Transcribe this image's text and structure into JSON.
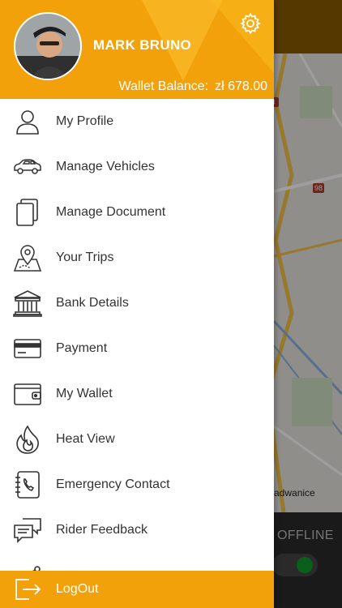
{
  "colors": {
    "accent": "#f3a10a",
    "accent_dark": "#f7b320",
    "text": "#333333",
    "online_green": "#119a2a"
  },
  "user": {
    "name": "MARK BRUNO"
  },
  "wallet": {
    "label": "Wallet Balance:",
    "amount": "zł 678.00"
  },
  "menu": [
    {
      "label": "My Profile",
      "icon": "user-icon"
    },
    {
      "label": "Manage Vehicles",
      "icon": "car-icon"
    },
    {
      "label": "Manage Document",
      "icon": "documents-icon"
    },
    {
      "label": "Your Trips",
      "icon": "map-pin-icon"
    },
    {
      "label": "Bank Details",
      "icon": "bank-icon"
    },
    {
      "label": "Payment",
      "icon": "credit-card-icon"
    },
    {
      "label": "My Wallet",
      "icon": "wallet-icon"
    },
    {
      "label": "Heat View",
      "icon": "fire-icon"
    },
    {
      "label": "Emergency Contact",
      "icon": "phone-book-icon"
    },
    {
      "label": "Rider Feedback",
      "icon": "chat-icon"
    }
  ],
  "logout": {
    "label": "LogOut",
    "icon": "logout-icon"
  },
  "background": {
    "status": "OFFLINE",
    "map_place": "adwanice",
    "road_signs": [
      "98",
      "8"
    ]
  }
}
